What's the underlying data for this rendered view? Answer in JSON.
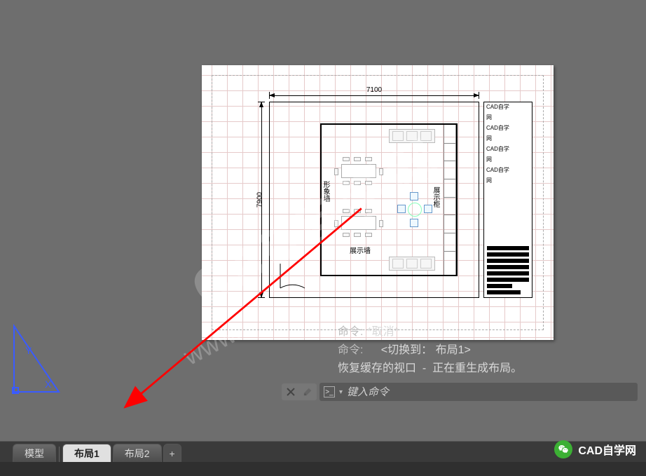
{
  "tabs": {
    "model": "模型",
    "layout1": "布局1",
    "layout2": "布局2",
    "add": "+"
  },
  "command_history": [
    {
      "prompt": "命令:",
      "text": "*取消*"
    },
    {
      "prompt": "命令:",
      "text": "<切换到： 布局1>"
    },
    {
      "prompt": "",
      "text": "恢复缓存的视口  -  正在重生成布局。"
    }
  ],
  "command_input": {
    "placeholder": "键入命令"
  },
  "brand": {
    "name": "CAD自学网"
  },
  "drawing": {
    "dim_top": "7100",
    "dim_left": "7900",
    "label_image_wall": "形象墙",
    "label_display": "展示柜",
    "label_display_bottom": "展示墙",
    "titleblock_lines": [
      "CAD自学",
      "网",
      "CAD自学",
      "网",
      "CAD自学",
      "网",
      "CAD自学",
      "网"
    ]
  },
  "watermark_main": "CAD自学网",
  "watermark_url": "www."
}
